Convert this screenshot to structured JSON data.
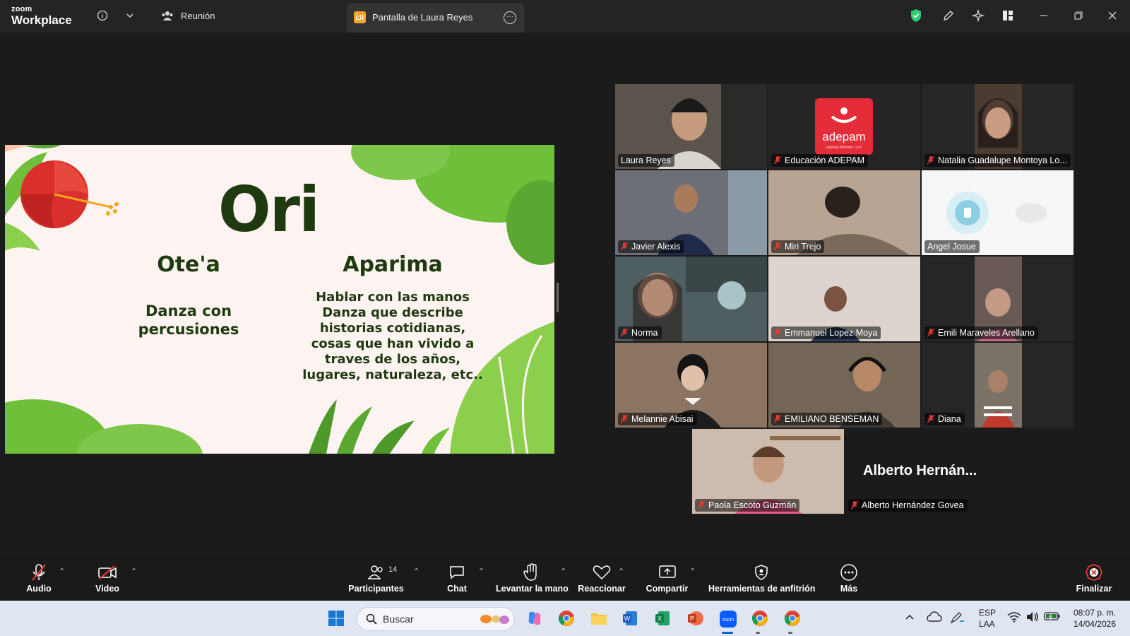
{
  "app": {
    "brand_small": "zoom",
    "brand_big": "Workplace",
    "meeting_label": "Reunión",
    "share_badge": "LR",
    "share_tab_label": "Pantalla de Laura Reyes"
  },
  "slide": {
    "title": "Ori",
    "col1_heading": "Ote'a",
    "col1_text": "Danza con percusiones",
    "col2_heading": "Aparima",
    "col2_lines": [
      "Hablar con las manos",
      "Danza que describe",
      "historias cotidianas,",
      "cosas que han vivido a",
      "traves de los años,",
      "lugares, naturaleza, etc.."
    ]
  },
  "participants": [
    {
      "name": "Laura Reyes",
      "muted": false,
      "active": true
    },
    {
      "name": "Educación ADEPAM",
      "muted": true,
      "logo": "adepam",
      "logo_sub": "Gabriela Brimmer I.A.P."
    },
    {
      "name": "Natalia Guadalupe Montoya Lo...",
      "muted": true
    },
    {
      "name": "Javier Alexis",
      "muted": true
    },
    {
      "name": "Miri Trejo",
      "muted": true
    },
    {
      "name": "Angel Josue",
      "muted": false
    },
    {
      "name": "Norma",
      "muted": true
    },
    {
      "name": "Emmanuel Lopez Moya",
      "muted": true
    },
    {
      "name": "Emili Maraveles Arellano",
      "muted": true
    },
    {
      "name": "Melannie Abisai",
      "muted": true
    },
    {
      "name": "EMILIANO BENSEMAN",
      "muted": true
    },
    {
      "name": "Diana",
      "muted": true
    },
    {
      "name": "Paola Escoto Guzmán",
      "muted": true
    },
    {
      "name": "Alberto Hernández Govea",
      "muted": true,
      "display_name": "Alberto Hernán..."
    }
  ],
  "toolbar": {
    "audio": "Audio",
    "video": "Video",
    "participants": "Participantes",
    "participants_count": "14",
    "chat": "Chat",
    "raise_hand": "Levantar la mano",
    "react": "Reaccionar",
    "share": "Compartir",
    "host_tools": "Herramientas de anfitrión",
    "more": "Más",
    "end": "Finalizar"
  },
  "taskbar": {
    "search_placeholder": "Buscar",
    "lang_top": "ESP",
    "lang_bottom": "LAA",
    "time": "08:07 p. m.",
    "date": "14/04/2026"
  },
  "colors": {
    "active_speaker": "#22d38a",
    "end_button": "#e53935",
    "adepam_red": "#e52d3a",
    "slide_text": "#1f3a10"
  }
}
